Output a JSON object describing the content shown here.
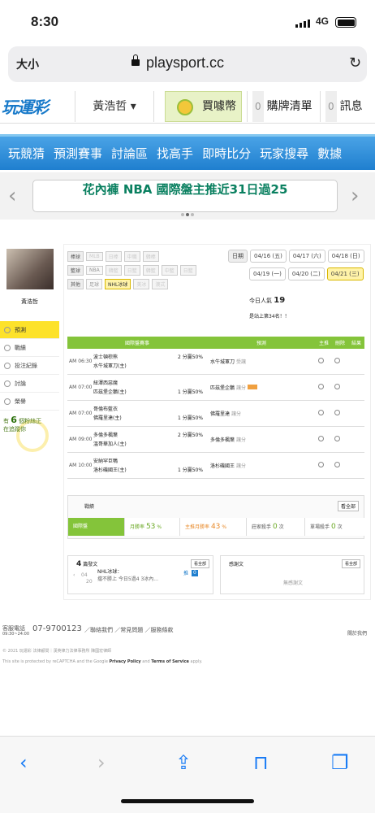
{
  "status": {
    "time": "8:30",
    "network": "4G"
  },
  "browser": {
    "aa": "大小",
    "domain": "playsport.cc"
  },
  "site_nav": {
    "logo": "玩運彩",
    "user": "黃浩哲 ▾",
    "buy": "買噱幣",
    "cart_count": "0",
    "cart_label": "購牌清單",
    "msg_count": "0",
    "msg_label": "訊息"
  },
  "main_nav": [
    "玩競猜",
    "預測賽事",
    "討論區",
    "找高手",
    "即時比分",
    "玩家搜尋",
    "數據"
  ],
  "banner": {
    "text": "花內褲 NBA 國際盤主推近31日過25",
    "left": "‹",
    "right": "›"
  },
  "sidebar": {
    "username": "黃浩哲",
    "items": [
      "預測",
      "戰績",
      "投注紀錄",
      "討論",
      "榮譽"
    ],
    "promo_prefix": "有",
    "promo_count": "6",
    "promo_suffix": "個粉絲正",
    "promo_line2": "在追蹤你"
  },
  "filters": {
    "rows": [
      {
        "label": "棒球",
        "items": [
          "MLB",
          "日棒",
          "中職",
          "韓棒"
        ]
      },
      {
        "label": "籃球",
        "items": [
          "NBA",
          "韓籃",
          "日籃",
          "韓籃",
          "中籃",
          "日籃"
        ]
      },
      {
        "label": "其他",
        "items": [
          "足球",
          "NHL冰球",
          "美冰",
          "澳式"
        ]
      }
    ]
  },
  "dates": {
    "label": "日期",
    "row1": [
      "04/16 (五)",
      "04/17 (六)",
      "04/18 (日)"
    ],
    "row2": [
      "04/19 (一)",
      "04/20 (二)",
      "04/21 (三)"
    ]
  },
  "popularity": {
    "label": "今日人氣",
    "value": "19"
  },
  "rank_text": "是站上第34名！！",
  "table": {
    "headers": [
      "國際盤賽事",
      "預測",
      "主推",
      "刪除",
      "結果"
    ],
    "rows": [
      {
        "time": "AM 06:30",
        "t1": "波士頓棕熊",
        "t2": "水牛城軍刀(主)",
        "hc": "2 分贏50%",
        "hc_row": 1,
        "pick": "水牛城軍刀",
        "note": "受讓"
      },
      {
        "time": "AM 07:00",
        "t1": "紐澤西惡魔",
        "t2": "匹茲堡企鵝(主)",
        "hc": "1 分贏50%",
        "hc_row": 2,
        "pick": "匹茲堡企鵝",
        "note": "讓分"
      },
      {
        "time": "AM 07:00",
        "t1": "哥倫布藍衣",
        "t2": "佛羅里達(主)",
        "hc": "1 分贏50%",
        "hc_row": 2,
        "pick": "佛羅里達",
        "note": "讓分"
      },
      {
        "time": "AM 09:00",
        "t1": "多倫多楓葉",
        "t2": "溫哥華加人(主)",
        "hc": "2 分贏50%",
        "hc_row": 1,
        "pick": "多倫多楓葉",
        "note": "讓分"
      },
      {
        "time": "AM 10:00",
        "t1": "安納罕巨鴨",
        "t2": "洛杉磯國王(主)",
        "hc": "1 分贏50%",
        "hc_row": 2,
        "pick": "洛杉磯國王",
        "note": "讓分"
      }
    ]
  },
  "record": {
    "title": "戰績",
    "all": "看全部",
    "cells": [
      {
        "label": "國際盤",
        "value": ""
      },
      {
        "label": "月勝率",
        "value": "53",
        "unit": "%"
      },
      {
        "label": "主推月勝率",
        "value": "43",
        "unit": "%"
      },
      {
        "label": "莊家殺手",
        "value": "0",
        "unit": "次"
      },
      {
        "label": "單場殺手",
        "value": "0",
        "unit": "次"
      }
    ]
  },
  "posts": {
    "count": "4",
    "label": "篇發文",
    "all": "看全部",
    "date_top": "04",
    "date_bot": "20",
    "title": "NHL冰球：",
    "snippet": "擋不勝上 今日5過4 3冰內...",
    "tag": "推",
    "reply": "0"
  },
  "thanks": {
    "label": "感謝文",
    "all": "看全部",
    "none": "無感謝文"
  },
  "footer": {
    "tel_label": "客服電話",
    "tel_hours": "09:30~24:00",
    "tel": "07-9700123",
    "links": "／聯絡我們 ／常見問題 ／服務條款",
    "right": "關於我們",
    "copyright": "© 2021 玩運彩 法律顧問｜漢英律力法律事務所 陳國宏律師",
    "recaptcha_pre": "This site is protected by reCAPTCHA and the Google ",
    "privacy": "Privacy Policy",
    "and": " and ",
    "terms": "Terms of Service",
    "apply": " apply."
  }
}
